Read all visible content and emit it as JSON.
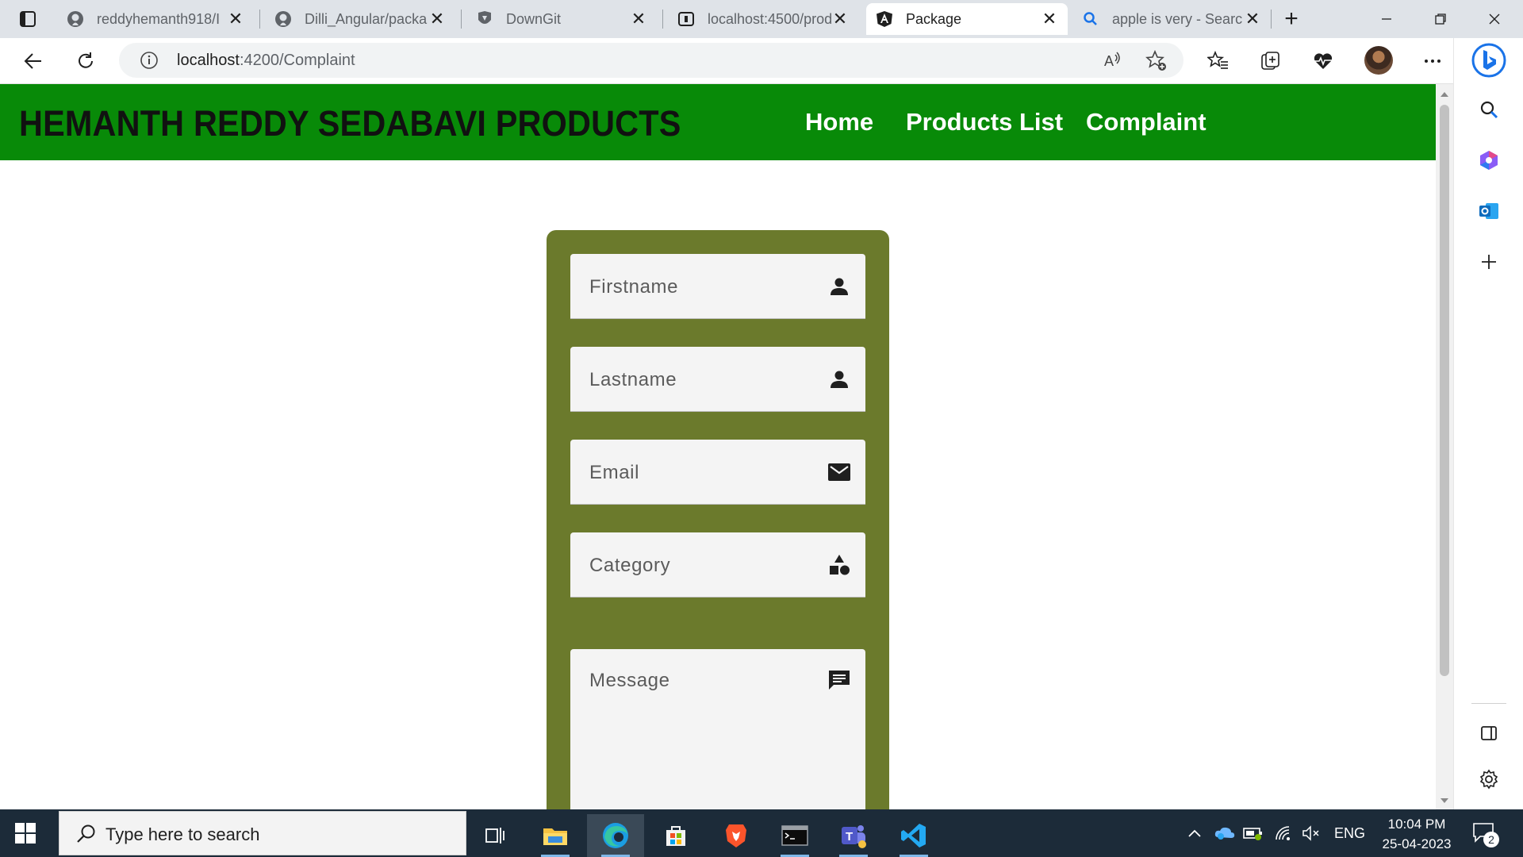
{
  "browser": {
    "tabs": [
      {
        "title": "reddyhemanth918/I",
        "icon": "github-icon"
      },
      {
        "title": "Dilli_Angular/packa",
        "icon": "github-icon"
      },
      {
        "title": "DownGit",
        "icon": "downgit-icon"
      },
      {
        "title": "localhost:4500/prod",
        "icon": "localhost-icon"
      },
      {
        "title": "Package",
        "icon": "angular-icon",
        "active": true
      },
      {
        "title": "apple is very - Searc",
        "icon": "search-icon"
      }
    ],
    "address": {
      "host": "localhost",
      "path": ":4200/Complaint"
    }
  },
  "page": {
    "brand": "HEMANTH REDDY SEDABAVI PRODUCTS",
    "nav": [
      "Home",
      "Products List",
      "Complaint"
    ],
    "form": {
      "firstname_placeholder": "Firstname",
      "lastname_placeholder": "Lastname",
      "email_placeholder": "Email",
      "category_placeholder": "Category",
      "message_placeholder": "Message"
    },
    "colors": {
      "navbar": "#088a08",
      "card": "#6b7a2c",
      "field": "#f4f4f4"
    }
  },
  "taskbar": {
    "search_placeholder": "Type here to search",
    "language": "ENG",
    "time": "10:04 PM",
    "date": "25-04-2023",
    "notification_count": "2"
  }
}
